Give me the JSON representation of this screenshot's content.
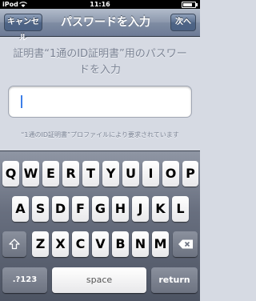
{
  "status_bar": {
    "carrier": "iPod",
    "time": "11:16"
  },
  "nav": {
    "cancel_label": "キャンセル",
    "title": "パスワードを入力",
    "next_label": "次へ"
  },
  "prompt": "証明書“1通のID証明書”用のパスワードを入力",
  "password_field": {
    "value": "",
    "placeholder": ""
  },
  "footer_note": "“1通のID証明書”プロファイルにより要求されています",
  "keyboard": {
    "row1": [
      "Q",
      "W",
      "E",
      "R",
      "T",
      "Y",
      "U",
      "I",
      "O",
      "P"
    ],
    "row2": [
      "A",
      "S",
      "D",
      "F",
      "G",
      "H",
      "J",
      "K",
      "L"
    ],
    "row3": [
      "Z",
      "X",
      "C",
      "V",
      "B",
      "N",
      "M"
    ],
    "numbers_key": ".?123",
    "space_key": "space",
    "return_key": "return",
    "shift_icon": "shift-arrow-icon",
    "delete_icon": "backspace-icon"
  },
  "colors": {
    "nav_bar": "#7f8ca3",
    "background": "#d6dae3",
    "cursor": "#3c7ee8"
  }
}
